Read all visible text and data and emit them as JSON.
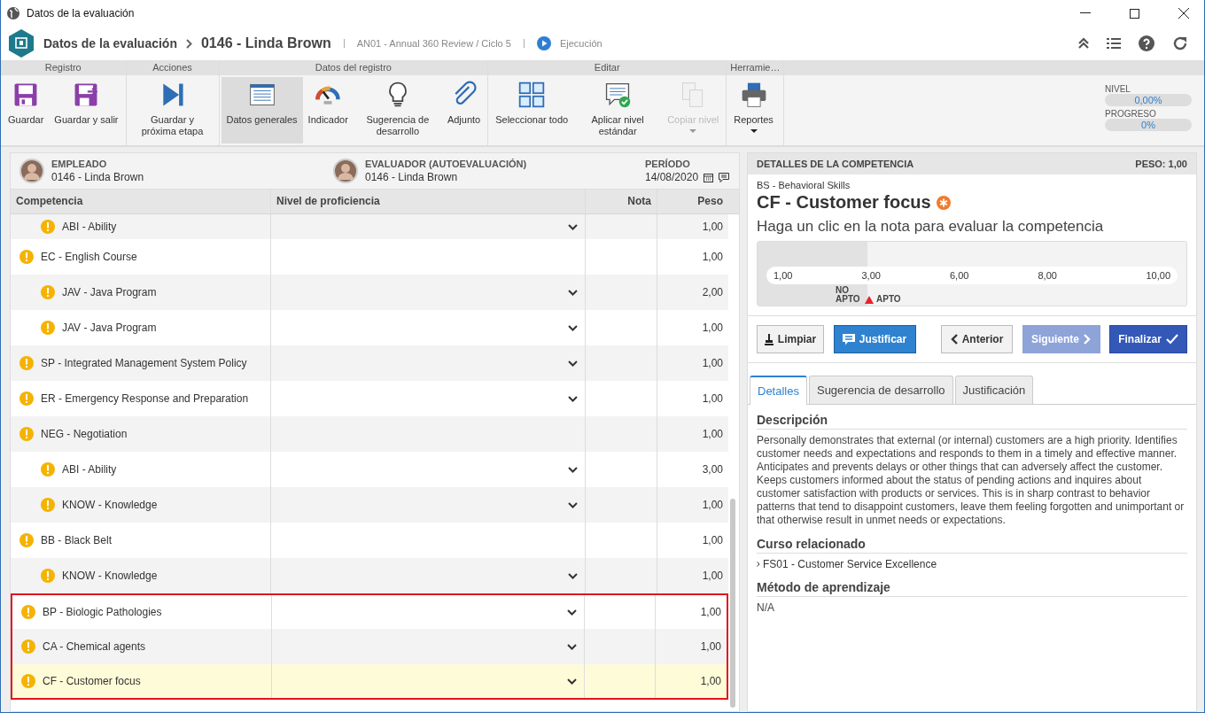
{
  "window": {
    "title": "Datos de la evaluación"
  },
  "header": {
    "module": "Datos de la evaluación",
    "record": "0146 - Linda Brown",
    "review": "AN01 - Annual 360 Review / Ciclo 5",
    "status": "Ejecución"
  },
  "ribbon": {
    "groups": [
      {
        "title": "Registro",
        "items": [
          {
            "kind": "save",
            "label": "Guardar",
            "selected": false,
            "disabled": false,
            "dropdown": false
          },
          {
            "kind": "save-exit",
            "label": "Guardar y salir",
            "selected": false,
            "disabled": false,
            "dropdown": false
          }
        ]
      },
      {
        "title": "Acciones",
        "items": [
          {
            "kind": "next",
            "label": "Guardar y próxima etapa",
            "selected": false,
            "disabled": false,
            "dropdown": false
          }
        ]
      },
      {
        "title": "Datos del registro",
        "items": [
          {
            "kind": "form",
            "label": "Datos generales",
            "selected": true,
            "disabled": false,
            "dropdown": false
          },
          {
            "kind": "gauge",
            "label": "Indicador",
            "selected": false,
            "disabled": false,
            "dropdown": false
          },
          {
            "kind": "bulb",
            "label": "Sugerencia de desarrollo",
            "selected": false,
            "disabled": false,
            "dropdown": false
          },
          {
            "kind": "clip",
            "label": "Adjunto",
            "selected": false,
            "disabled": false,
            "dropdown": false
          }
        ]
      },
      {
        "title": "Editar",
        "items": [
          {
            "kind": "grid",
            "label": "Seleccionar todo",
            "selected": false,
            "disabled": false,
            "dropdown": false
          },
          {
            "kind": "apply",
            "label": "Aplicar nivel estándar",
            "selected": false,
            "disabled": false,
            "dropdown": false
          },
          {
            "kind": "copy",
            "label": "Copiar nivel",
            "selected": false,
            "disabled": true,
            "dropdown": true
          }
        ]
      },
      {
        "title": "Herramie…",
        "items": [
          {
            "kind": "printer",
            "label": "Reportes",
            "selected": false,
            "disabled": false,
            "dropdown": true
          }
        ]
      }
    ],
    "meters": [
      {
        "label": "NIVEL",
        "value": "0,00%",
        "level": 0
      },
      {
        "label": "PROGRESO",
        "value": "0%",
        "level": 0
      }
    ]
  },
  "info": {
    "employee_label": "EMPLEADO",
    "employee": "0146 - Linda Brown",
    "evaluator_label": "EVALUADOR (AUTOEVALUACIÓN)",
    "evaluator": "0146 - Linda Brown",
    "period_label": "PERÍODO",
    "period": "14/08/2020"
  },
  "table": {
    "columns": [
      "Competencia",
      "Nivel de proficiencia",
      "Nota",
      "Peso"
    ],
    "rows": [
      {
        "children": [
          {
            "name": "ABI - Ability",
            "dropdown": true,
            "weight": "1,00",
            "selected": false,
            "marked": false
          }
        ]
      },
      {
        "name": "EC - English Course",
        "dropdown": false,
        "weight": "1,00",
        "selected": false,
        "marked": false,
        "children": [
          {
            "name": "JAV - Java Program",
            "dropdown": true,
            "weight": "2,00",
            "selected": false,
            "marked": false
          },
          {
            "name": "JAV - Java Program",
            "dropdown": true,
            "weight": "1,00",
            "selected": false,
            "marked": false
          }
        ]
      },
      {
        "name": "SP - Integrated Management System Policy",
        "dropdown": true,
        "weight": "1,00",
        "selected": false,
        "marked": false
      },
      {
        "name": "ER - Emergency Response and Preparation",
        "dropdown": true,
        "weight": "1,00",
        "selected": false,
        "marked": false
      },
      {
        "name": "NEG - Negotiation",
        "dropdown": false,
        "weight": "1,00",
        "selected": false,
        "marked": false,
        "children": [
          {
            "name": "ABI - Ability",
            "dropdown": true,
            "weight": "3,00",
            "selected": false,
            "marked": false
          },
          {
            "name": "KNOW - Knowledge",
            "dropdown": true,
            "weight": "1,00",
            "selected": false,
            "marked": false
          }
        ]
      },
      {
        "name": "BB - Black Belt",
        "dropdown": false,
        "weight": "1,00",
        "selected": false,
        "marked": false,
        "children": [
          {
            "name": "KNOW - Knowledge",
            "dropdown": true,
            "weight": "1,00",
            "selected": false,
            "marked": false
          }
        ]
      },
      {
        "name": "BP - Biologic Pathologies",
        "dropdown": true,
        "weight": "1,00",
        "selected": false,
        "marked": true
      },
      {
        "name": "CA - Chemical agents",
        "dropdown": true,
        "weight": "1,00",
        "selected": false,
        "marked": true
      },
      {
        "name": "CF - Customer focus",
        "dropdown": true,
        "weight": "1,00",
        "selected": true,
        "marked": true
      }
    ]
  },
  "details": {
    "title": "DETALLES DE LA COMPETENCIA",
    "weight": "PESO: 1,00",
    "group": "BS - Behavioral Skills",
    "name": "CF - Customer focus",
    "hint": "Haga un clic en la nota para evaluar la competencia",
    "scale": {
      "ticks": [
        "1,00",
        "3,00",
        "6,00",
        "8,00",
        "10,00"
      ],
      "fail": "NO APTO",
      "pass": "APTO"
    },
    "buttons": [
      {
        "kind": "clear",
        "label": "Limpiar",
        "disabled": false
      },
      {
        "kind": "justify",
        "label": "Justificar",
        "disabled": false
      },
      {
        "kind": "prev",
        "label": "Anterior",
        "disabled": false
      },
      {
        "kind": "next",
        "label": "Siguiente",
        "disabled": true
      },
      {
        "kind": "finish",
        "label": "Finalizar",
        "disabled": false
      }
    ],
    "tabs": [
      {
        "label": "Detalles",
        "selected": true
      },
      {
        "label": "Sugerencia de desarrollo",
        "selected": false
      },
      {
        "label": "Justificación",
        "selected": false
      }
    ],
    "sections": [
      {
        "heading": "Descripción",
        "kind": "text",
        "text": "Personally demonstrates that external (or internal) customers are a high priority. Identifies customer needs and expectations and responds to them in a timely and effective manner. Anticipates and prevents delays or other things that can adversely affect the customer. Keeps customers informed about the status of pending actions and inquires about customer satisfaction with products or services. This is in sharp contrast to behavior patterns that tend to disappoint customers, leave them feeling forgotten and unimportant or that otherwise result in unmet needs or expectations."
      },
      {
        "heading": "Curso relacionado",
        "kind": "link",
        "text": "FS01 - Customer Service Excellence"
      },
      {
        "heading": "Método de aprendizaje",
        "kind": "text",
        "text": "N/A"
      }
    ]
  }
}
